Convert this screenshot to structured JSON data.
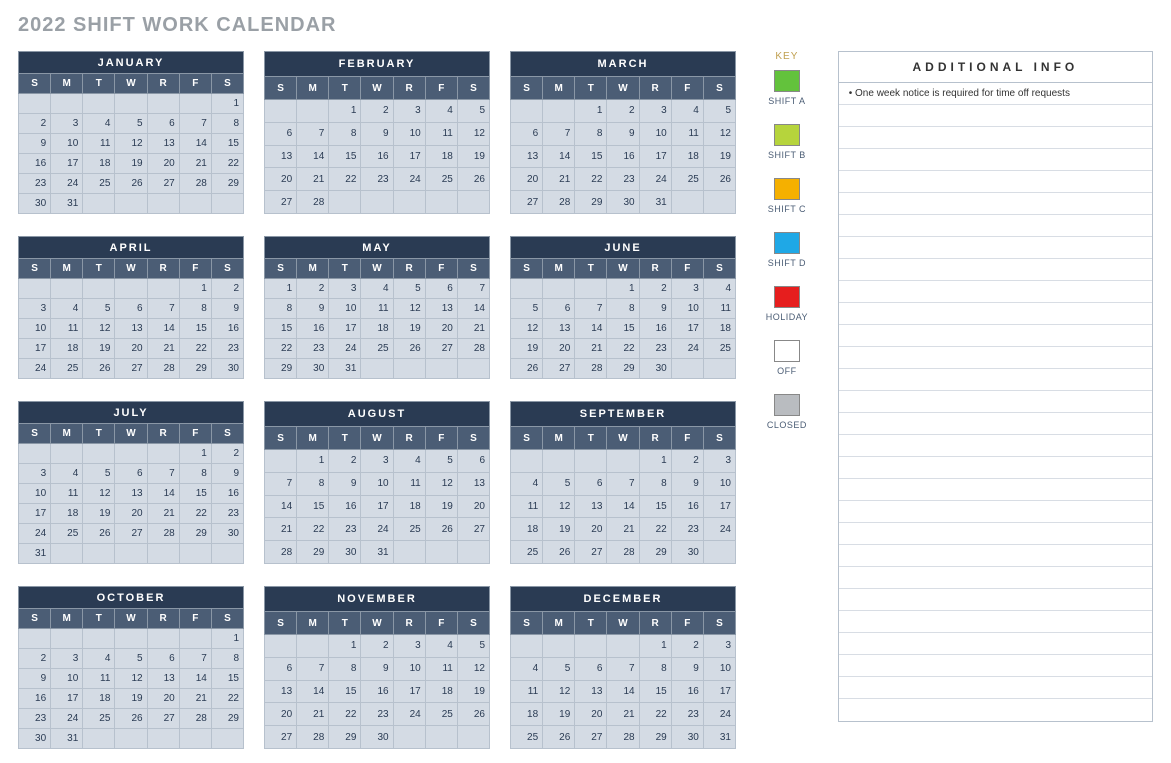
{
  "title": "2022 SHIFT WORK CALENDAR",
  "dow": [
    "S",
    "M",
    "T",
    "W",
    "R",
    "F",
    "S"
  ],
  "months": [
    {
      "name": "JANUARY",
      "start": 6,
      "days": 31
    },
    {
      "name": "FEBRUARY",
      "start": 2,
      "days": 28
    },
    {
      "name": "MARCH",
      "start": 2,
      "days": 31
    },
    {
      "name": "APRIL",
      "start": 5,
      "days": 30
    },
    {
      "name": "MAY",
      "start": 0,
      "days": 31
    },
    {
      "name": "JUNE",
      "start": 3,
      "days": 30
    },
    {
      "name": "JULY",
      "start": 5,
      "days": 31
    },
    {
      "name": "AUGUST",
      "start": 1,
      "days": 31
    },
    {
      "name": "SEPTEMBER",
      "start": 4,
      "days": 30
    },
    {
      "name": "OCTOBER",
      "start": 6,
      "days": 31
    },
    {
      "name": "NOVEMBER",
      "start": 2,
      "days": 30
    },
    {
      "name": "DECEMBER",
      "start": 4,
      "days": 31
    }
  ],
  "key": {
    "title": "KEY",
    "items": [
      {
        "label": "SHIFT A",
        "color": "#63c23c"
      },
      {
        "label": "SHIFT B",
        "color": "#b6d43c"
      },
      {
        "label": "SHIFT C",
        "color": "#f5b000"
      },
      {
        "label": "SHIFT D",
        "color": "#1fa8e6"
      },
      {
        "label": "HOLIDAY",
        "color": "#e61e1e"
      },
      {
        "label": "OFF",
        "color": "#ffffff"
      },
      {
        "label": "CLOSED",
        "color": "#b9bcc0"
      }
    ]
  },
  "info": {
    "title": "ADDITIONAL INFO",
    "rows": [
      "• One week notice is required for time off requests",
      "",
      "",
      "",
      "",
      "",
      "",
      "",
      "",
      "",
      "",
      "",
      "",
      "",
      "",
      "",
      "",
      "",
      "",
      "",
      "",
      "",
      "",
      "",
      "",
      "",
      "",
      "",
      ""
    ]
  }
}
